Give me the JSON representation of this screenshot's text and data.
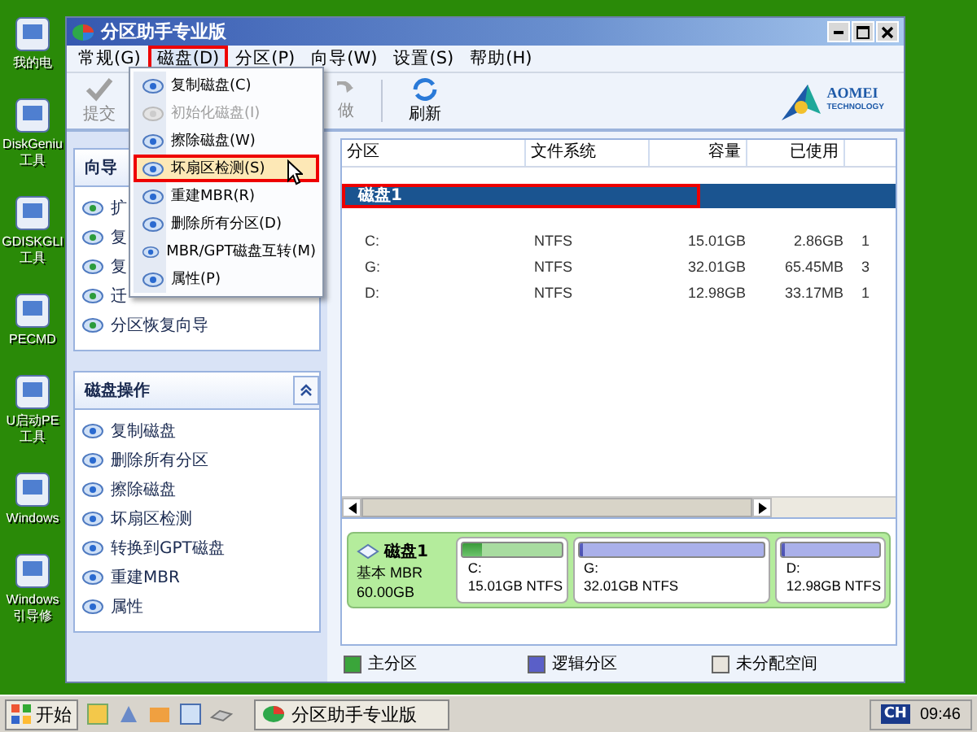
{
  "desktop_icons": [
    {
      "lines": [
        "我的电"
      ]
    },
    {
      "lines": [
        "DiskGeniu",
        "工具"
      ]
    },
    {
      "lines": [
        "GDISKGLI",
        "工具"
      ]
    },
    {
      "lines": [
        "PECMD"
      ]
    },
    {
      "lines": [
        "U启动PE",
        "工具"
      ]
    },
    {
      "lines": [
        "Windows"
      ]
    },
    {
      "lines": [
        "Windows",
        "引导修"
      ]
    }
  ],
  "window": {
    "title": "分区助手专业版"
  },
  "menu": [
    {
      "label": "常规(G)",
      "open": false,
      "annotated": false
    },
    {
      "label": "磁盘(D)",
      "open": true,
      "annotated": true
    },
    {
      "label": "分区(P)",
      "open": false,
      "annotated": false
    },
    {
      "label": "向导(W)",
      "open": false,
      "annotated": false
    },
    {
      "label": "设置(S)",
      "open": false,
      "annotated": false
    },
    {
      "label": "帮助(H)",
      "open": false,
      "annotated": false
    }
  ],
  "dropdown": [
    {
      "label": "复制磁盘(C)",
      "disabled": false,
      "selected": false,
      "annotated": false
    },
    {
      "label": "初始化磁盘(I)",
      "disabled": true,
      "selected": false,
      "annotated": false
    },
    {
      "label": "擦除磁盘(W)",
      "disabled": false,
      "selected": false,
      "annotated": false
    },
    {
      "label": "坏扇区检测(S)",
      "disabled": false,
      "selected": true,
      "annotated": true
    },
    {
      "label": "重建MBR(R)",
      "disabled": false,
      "selected": false,
      "annotated": false
    },
    {
      "label": "删除所有分区(D)",
      "disabled": false,
      "selected": false,
      "annotated": false
    },
    {
      "label": "MBR/GPT磁盘互转(M)",
      "disabled": false,
      "selected": false,
      "annotated": false
    },
    {
      "label": "属性(P)",
      "disabled": false,
      "selected": false,
      "annotated": false
    }
  ],
  "toolbar": [
    {
      "label": "提交",
      "disabled": true
    },
    {
      "label": "做",
      "disabled": true
    },
    {
      "label": "刷新",
      "disabled": false
    }
  ],
  "logo": {
    "name": "AOMEI",
    "sub": "TECHNOLOGY"
  },
  "wizard_panel": {
    "title": "向导",
    "items": [
      "扩",
      "复",
      "复",
      "迁",
      "分区恢复向导"
    ]
  },
  "disk_ops_panel": {
    "title": "磁盘操作",
    "expanded": true,
    "items": [
      "复制磁盘",
      "删除所有分区",
      "擦除磁盘",
      "坏扇区检测",
      "转换到GPT磁盘",
      "重建MBR",
      "属性"
    ]
  },
  "table": {
    "columns": [
      "分区",
      "文件系统",
      "容量",
      "已使用"
    ],
    "rows": [
      {
        "kind": "disk",
        "cells": [
          "磁盘1"
        ],
        "annotated": true
      },
      {
        "kind": "partition",
        "cells": [
          "C:",
          "NTFS",
          "15.01GB",
          "2.86GB",
          "1"
        ],
        "annotated": false
      },
      {
        "kind": "partition",
        "cells": [
          "G:",
          "NTFS",
          "32.01GB",
          "65.45MB",
          "3"
        ],
        "annotated": false
      },
      {
        "kind": "partition",
        "cells": [
          "D:",
          "NTFS",
          "12.98GB",
          "33.17MB",
          "1"
        ],
        "annotated": false
      }
    ]
  },
  "disk_map": {
    "disk": {
      "name": "磁盘1",
      "type": "基本 MBR",
      "size": "60.00GB"
    },
    "partitions": [
      {
        "kind": "primary",
        "label": "C:",
        "info": "15.01GB NTFS",
        "level": 0.19
      },
      {
        "kind": "logical",
        "label": "G:",
        "info": "32.01GB NTFS",
        "level": 0.01
      },
      {
        "kind": "logical",
        "label": "D:",
        "info": "12.98GB NTFS",
        "level": 0.01
      }
    ]
  },
  "legend": [
    {
      "kind": "primary",
      "label": "主分区"
    },
    {
      "kind": "logical",
      "label": "逻辑分区"
    },
    {
      "kind": "unallocated",
      "label": "未分配空间"
    }
  ],
  "taskbar": {
    "start": "开始",
    "tasks": [
      "分区助手专业版"
    ],
    "lang": "CH",
    "time": "09:46"
  }
}
